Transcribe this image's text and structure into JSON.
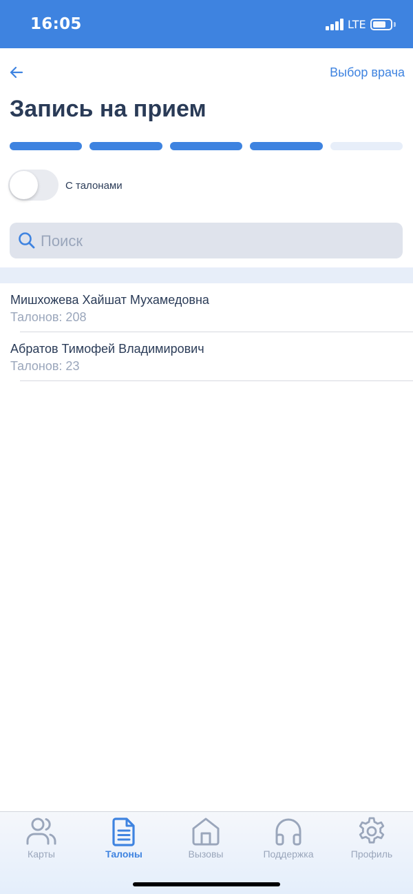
{
  "status_bar": {
    "time": "16:05",
    "network": "LTE"
  },
  "nav": {
    "right_label": "Выбор врача"
  },
  "page": {
    "title": "Запись на прием"
  },
  "progress": {
    "steps_total": 5,
    "steps_done": 4,
    "active_color": "#3e83e0",
    "inactive_color": "#e7eef9"
  },
  "filter": {
    "toggle_label": "С талонами",
    "toggle_on": false
  },
  "search": {
    "placeholder": "Поиск"
  },
  "doctors": [
    {
      "name": "Мишхожева Хайшат Мухамедовна",
      "count_label": "Талонов: 208"
    },
    {
      "name": "Абратов Тимофей Владимирович",
      "count_label": "Талонов: 23"
    }
  ],
  "tabbar": {
    "items": [
      {
        "label": "Карты",
        "icon": "users-icon",
        "active": false
      },
      {
        "label": "Талоны",
        "icon": "document-icon",
        "active": true
      },
      {
        "label": "Вызовы",
        "icon": "home-icon",
        "active": false
      },
      {
        "label": "Поддержка",
        "icon": "headphones-icon",
        "active": false
      },
      {
        "label": "Профиль",
        "icon": "gear-icon",
        "active": false
      }
    ]
  },
  "colors": {
    "accent": "#3e83e0",
    "text": "#2a3b57",
    "muted": "#9aa6bb"
  }
}
